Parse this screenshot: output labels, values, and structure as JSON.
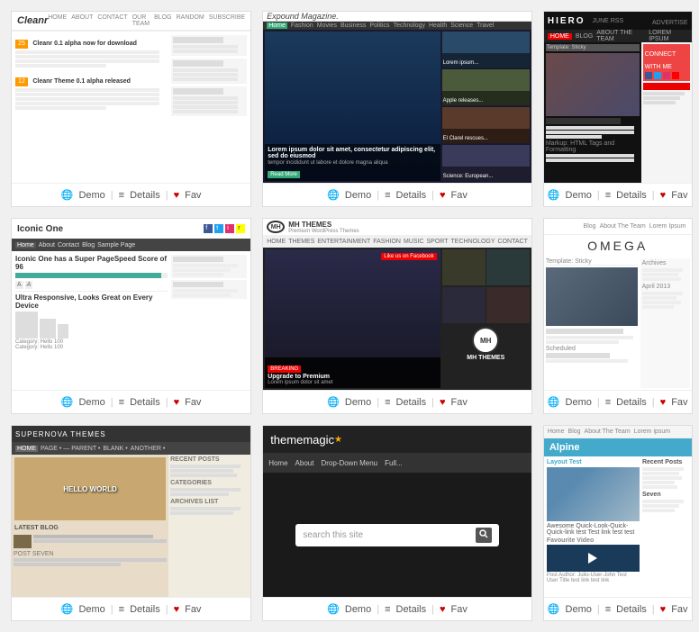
{
  "themes": [
    {
      "id": "cleanr",
      "name": "Cleanr",
      "demo_label": "Demo",
      "details_label": "Details",
      "fav_label": "Fav"
    },
    {
      "id": "expound",
      "name": "Expound Magazine",
      "demo_label": "Demo",
      "details_label": "Details",
      "fav_label": "Fav"
    },
    {
      "id": "hiero",
      "name": "Hiero",
      "demo_label": "Demo",
      "details_label": "Details",
      "fav_label": "Fav"
    },
    {
      "id": "iconic",
      "name": "Iconic One",
      "demo_label": "Demo",
      "details_label": "Details",
      "fav_label": "Fav"
    },
    {
      "id": "mhthemes",
      "name": "MH Themes",
      "demo_label": "Demo",
      "details_label": "Details",
      "fav_label": "Fav"
    },
    {
      "id": "omega",
      "name": "Omega",
      "demo_label": "Demo",
      "details_label": "Details",
      "fav_label": "Fav"
    },
    {
      "id": "supernova",
      "name": "Supernova",
      "demo_label": "Demo",
      "details_label": "Details",
      "fav_label": "Fav"
    },
    {
      "id": "thememagic",
      "name": "thememagic",
      "demo_label": "Demo",
      "details_label": "Details",
      "fav_label": "Fav",
      "search_placeholder": "search this site"
    },
    {
      "id": "alpine",
      "name": "Alpine",
      "demo_label": "Demo",
      "details_label": "Details",
      "fav_label": "Fav"
    }
  ],
  "actions": {
    "demo": "Demo",
    "details": "Details",
    "fav": "Fav"
  }
}
